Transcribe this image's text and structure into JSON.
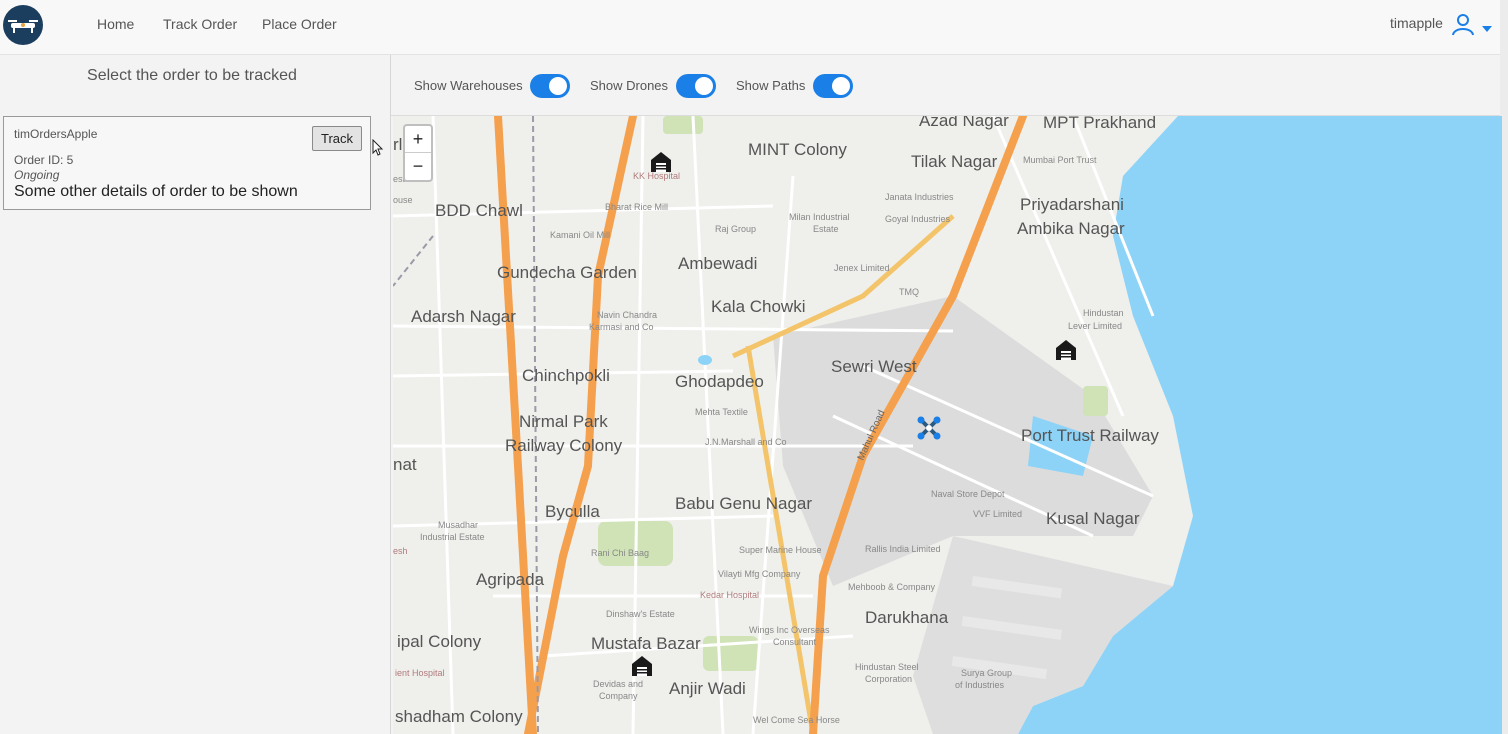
{
  "nav": {
    "home_label": "Home",
    "track_order_label": "Track Order",
    "place_order_label": "Place Order",
    "username": "timapple"
  },
  "sidebar": {
    "title": "Select the order to be tracked",
    "orders": [
      {
        "name": "timOrdersApple",
        "order_id": "Order ID: 5",
        "status": "Ongoing",
        "details": "Some other details of order to be shown",
        "track_label": "Track"
      }
    ]
  },
  "toggles": {
    "warehouses": {
      "label": "Show Warehouses",
      "on": true
    },
    "drones": {
      "label": "Show Drones",
      "on": true
    },
    "paths": {
      "label": "Show Paths",
      "on": true
    }
  },
  "map": {
    "zoom_in": "+",
    "zoom_out": "−",
    "labels": {
      "azad_nagar": "Azad Nagar",
      "mpt_prakhand": "MPT Prakhand",
      "mumbai_port_trust": "Mumbai Port Trust",
      "mint_colony": "MINT Colony",
      "tilak_nagar": "Tilak Nagar",
      "kk_hospital": "KK Hospital",
      "bharat_rice_mill": "Bharat Rice Mill",
      "janata_industries": "Janata Industries",
      "goyal_industries": "Goyal Industries",
      "priyadarshani": "Priyadarshani",
      "ambika_nagar": "Ambika Nagar",
      "bdd_chawl": "BDD Chawl",
      "milan_industrial": "Milan Industrial",
      "estate": "Estate",
      "raj_group": "Raj Group",
      "kamani_oil_mill": "Kamani Oil Mill",
      "gundecha_garden": "Gundecha Garden",
      "ambewadi": "Ambewadi",
      "jenex_limited": "Jenex Limited",
      "tmq": "TMQ",
      "kala_chowki": "Kala Chowki",
      "adarsh_nagar": "Adarsh Nagar",
      "navin_chandra": "Navin Chandra",
      "karmasi_and_co": "Karmasi and Co",
      "hindustan": "Hindustan",
      "lever_limited": "Lever Limited",
      "sewri_west": "Sewri West",
      "chinchpokli": "Chinchpokli",
      "ghodapdeo": "Ghodapdeo",
      "mehta_textile": "Mehta Textile",
      "mahul_road": "Mahul Road",
      "nirmal_park": "Nirmal Park",
      "railway_colony": "Railway Colony",
      "jn_marshall": "J.N.Marshall and Co",
      "port_trust_railway": "Port Trust Railway",
      "babu_genu_nagar": "Babu Genu Nagar",
      "naval_store_depot": "Naval Store Depot",
      "vvf_limited": "VVF Limited",
      "kusal_nagar": "Kusal Nagar",
      "byculla": "Byculla",
      "musadhar": "Musadhar",
      "industrial_estate": "Industrial Estate",
      "rani_chi_baag": "Rani Chi Baag",
      "super_marine_house": "Super Marine House",
      "rallis_india": "Rallis India Limited",
      "agripada": "Agripada",
      "vilayati_mfg": "Vilayti Mfg Company",
      "mehboob": "Mehboob & Company",
      "kedar_hospital": "Kedar Hospital",
      "dinshaw_estate": "Dinshaw's Estate",
      "darukhana": "Darukhana",
      "wings_inc": "Wings Inc Overseas",
      "consultant": "Consultant",
      "mustafa_bazar": "Mustafa Bazar",
      "hindustan_steel": "Hindustan Steel",
      "corporation": "Corporation",
      "surya_group": "Surya Group",
      "of_industries": "of Industries",
      "devidas": "Devidas and",
      "company": "Company",
      "anjir_wadi": "Anjir Wadi",
      "ipal_colony": "ipal Colony",
      "ient_hospital": "ient Hospital",
      "shadham_colony": "shadham Colony",
      "well_come": "Wel Come Sea Horse",
      "nat": "nat",
      "esh": "esh",
      "rl": "rl",
      "ouse": "ouse",
      "estate_left": "estate"
    }
  },
  "colors": {
    "accent": "#1a7fe6",
    "navbar_bg": "#f8f8f8",
    "water": "#8dd3f7",
    "major_road": "#f5a04d",
    "minor_road_casing": "#f3c46a",
    "park": "#cfe3b7",
    "logo_bg": "#1c3e5e"
  },
  "icons": {
    "logo": "drone-logo-icon",
    "user": "user-icon",
    "dropdown": "chevron-down-icon",
    "warehouse": "warehouse-icon",
    "drone": "drone-icon",
    "cursor": "mouse-cursor-icon"
  }
}
